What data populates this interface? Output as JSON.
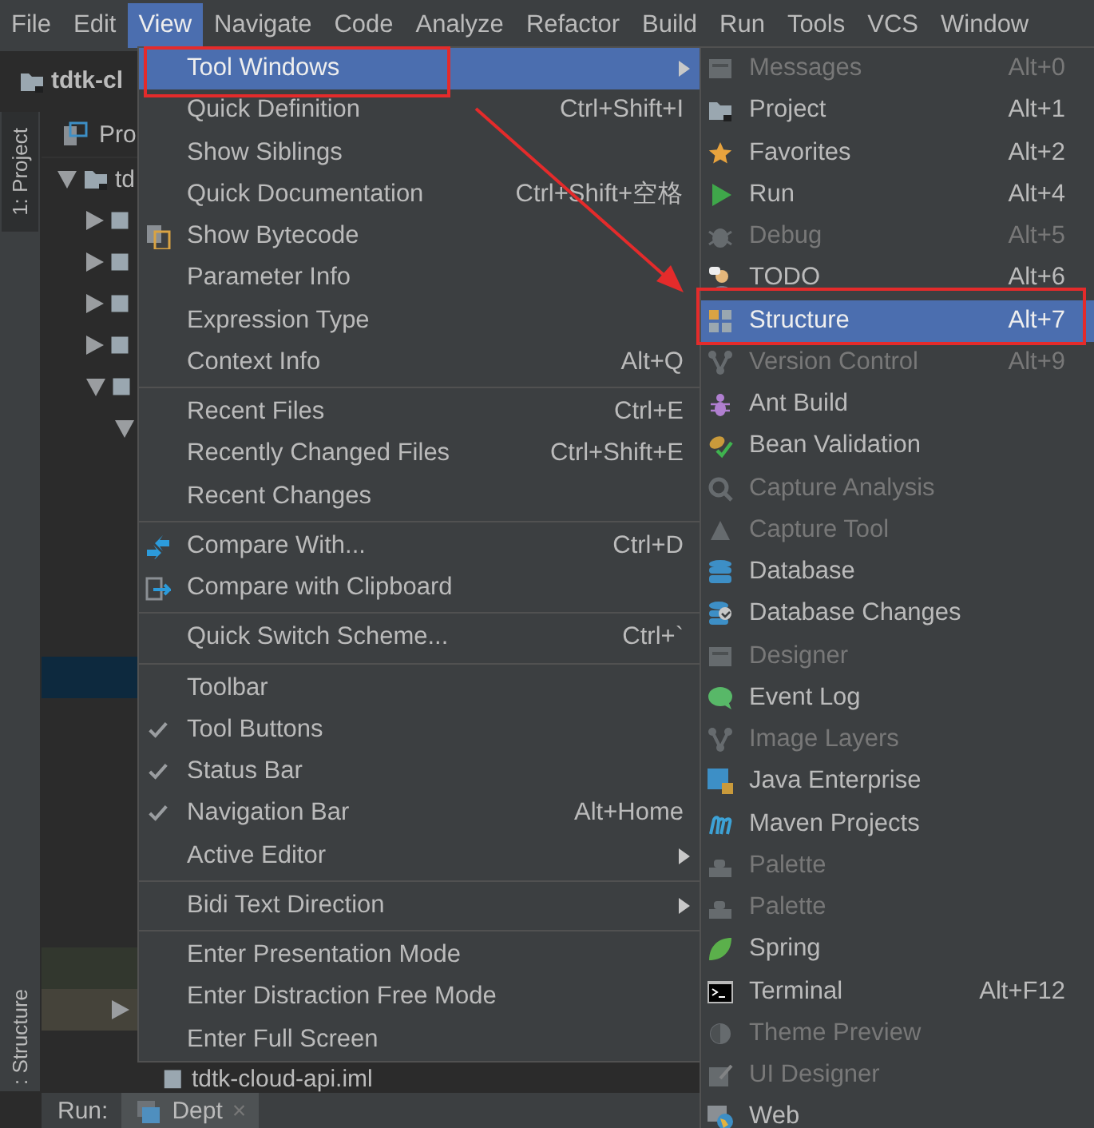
{
  "menu_bar": [
    {
      "label": "File",
      "selected": false
    },
    {
      "label": "Edit",
      "selected": false
    },
    {
      "label": "View",
      "selected": true
    },
    {
      "label": "Navigate",
      "selected": false
    },
    {
      "label": "Code",
      "selected": false
    },
    {
      "label": "Analyze",
      "selected": false
    },
    {
      "label": "Refactor",
      "selected": false
    },
    {
      "label": "Build",
      "selected": false
    },
    {
      "label": "Run",
      "selected": false
    },
    {
      "label": "Tools",
      "selected": false
    },
    {
      "label": "VCS",
      "selected": false
    },
    {
      "label": "Window",
      "selected": false
    }
  ],
  "project_panel": {
    "title": "tdtk-cl",
    "side_tabs": [
      "1: Project",
      ": Structure"
    ],
    "header": "Pro",
    "tree": {
      "label": "td",
      "expanded": true,
      "children": [
        {
          "expanded": false
        },
        {
          "expanded": false
        },
        {
          "expanded": false
        },
        {
          "expanded": false
        },
        {
          "expanded": true,
          "children": [
            {
              "expanded": true
            }
          ]
        }
      ]
    },
    "lower_rows": [
      {
        "kind": "selected"
      },
      {
        "kind": "modified"
      },
      {
        "kind": "node",
        "expanded": false
      }
    ],
    "file_name": "tdtk-cloud-api.iml"
  },
  "run_bar": {
    "label": "Run:",
    "tabs": [
      {
        "label": "Dept",
        "close": "×"
      }
    ]
  },
  "view_menu": {
    "groups": [
      {
        "items": [
          {
            "label": "Tool Windows",
            "submenu": true,
            "selected": true
          },
          {
            "label": "Quick Definition",
            "shortcut": "Ctrl+Shift+I",
            "selected": false
          },
          {
            "label": "Show Siblings",
            "selected": false
          },
          {
            "label": "Quick Documentation",
            "shortcut": "Ctrl+Shift+空格",
            "selected": false
          },
          {
            "label": "Show Bytecode",
            "selected": false
          },
          {
            "label": "Parameter Info",
            "selected": false
          },
          {
            "label": "Expression Type",
            "selected": false
          },
          {
            "label": "Context Info",
            "shortcut": "Alt+Q",
            "selected": false
          }
        ]
      },
      {
        "items": [
          {
            "label": "Recent Files",
            "shortcut": "Ctrl+E",
            "selected": false
          },
          {
            "label": "Recently Changed Files",
            "shortcut": "Ctrl+Shift+E",
            "selected": false
          },
          {
            "label": "Recent Changes",
            "selected": false
          }
        ]
      },
      {
        "items": [
          {
            "label": "Compare With...",
            "shortcut": "Ctrl+D",
            "selected": false
          },
          {
            "label": "Compare with Clipboard",
            "selected": false
          }
        ]
      },
      {
        "items": [
          {
            "label": "Quick Switch Scheme...",
            "shortcut": "Ctrl+`",
            "selected": false
          }
        ]
      },
      {
        "items": [
          {
            "label": "Toolbar",
            "checked": false,
            "selected": false
          },
          {
            "label": "Tool Buttons",
            "checked": true,
            "selected": false
          },
          {
            "label": "Status Bar",
            "checked": true,
            "selected": false
          },
          {
            "label": "Navigation Bar",
            "shortcut": "Alt+Home",
            "checked": true,
            "selected": false
          },
          {
            "label": "Active Editor",
            "submenu": true,
            "selected": false
          }
        ]
      },
      {
        "items": [
          {
            "label": "Bidi Text Direction",
            "submenu": true,
            "selected": false
          }
        ]
      },
      {
        "items": [
          {
            "label": "Enter Presentation Mode",
            "selected": false
          },
          {
            "label": "Enter Distraction Free Mode",
            "selected": false
          },
          {
            "label": "Enter Full Screen",
            "selected": false
          }
        ]
      }
    ]
  },
  "tool_windows_menu": {
    "items": [
      {
        "label": "Messages",
        "shortcut": "Alt+0",
        "disabled": true,
        "selected": false
      },
      {
        "label": "Project",
        "shortcut": "Alt+1",
        "disabled": false,
        "selected": false
      },
      {
        "label": "Favorites",
        "shortcut": "Alt+2",
        "disabled": false,
        "selected": false
      },
      {
        "label": "Run",
        "shortcut": "Alt+4",
        "disabled": false,
        "selected": false
      },
      {
        "label": "Debug",
        "shortcut": "Alt+5",
        "disabled": true,
        "selected": false
      },
      {
        "label": "TODO",
        "shortcut": "Alt+6",
        "disabled": false,
        "selected": false
      },
      {
        "label": "Structure",
        "shortcut": "Alt+7",
        "disabled": false,
        "selected": true
      },
      {
        "label": "Version Control",
        "shortcut": "Alt+9",
        "disabled": true,
        "selected": false
      },
      {
        "label": "Ant Build",
        "disabled": false,
        "selected": false
      },
      {
        "label": "Bean Validation",
        "disabled": false,
        "selected": false
      },
      {
        "label": "Capture Analysis",
        "disabled": true,
        "selected": false
      },
      {
        "label": "Capture Tool",
        "disabled": true,
        "selected": false
      },
      {
        "label": "Database",
        "disabled": false,
        "selected": false
      },
      {
        "label": "Database Changes",
        "disabled": false,
        "selected": false
      },
      {
        "label": "Designer",
        "disabled": true,
        "selected": false
      },
      {
        "label": "Event Log",
        "disabled": false,
        "selected": false
      },
      {
        "label": "Image Layers",
        "disabled": true,
        "selected": false
      },
      {
        "label": "Java Enterprise",
        "disabled": false,
        "selected": false
      },
      {
        "label": "Maven Projects",
        "disabled": false,
        "selected": false
      },
      {
        "label": "Palette",
        "disabled": true,
        "selected": false
      },
      {
        "label": "Palette",
        "disabled": true,
        "selected": false
      },
      {
        "label": "Spring",
        "disabled": false,
        "selected": false
      },
      {
        "label": "Terminal",
        "shortcut": "Alt+F12",
        "disabled": false,
        "selected": false
      },
      {
        "label": "Theme Preview",
        "disabled": true,
        "selected": false
      },
      {
        "label": "UI Designer",
        "disabled": true,
        "selected": false
      },
      {
        "label": "Web",
        "disabled": false,
        "selected": false
      }
    ]
  }
}
